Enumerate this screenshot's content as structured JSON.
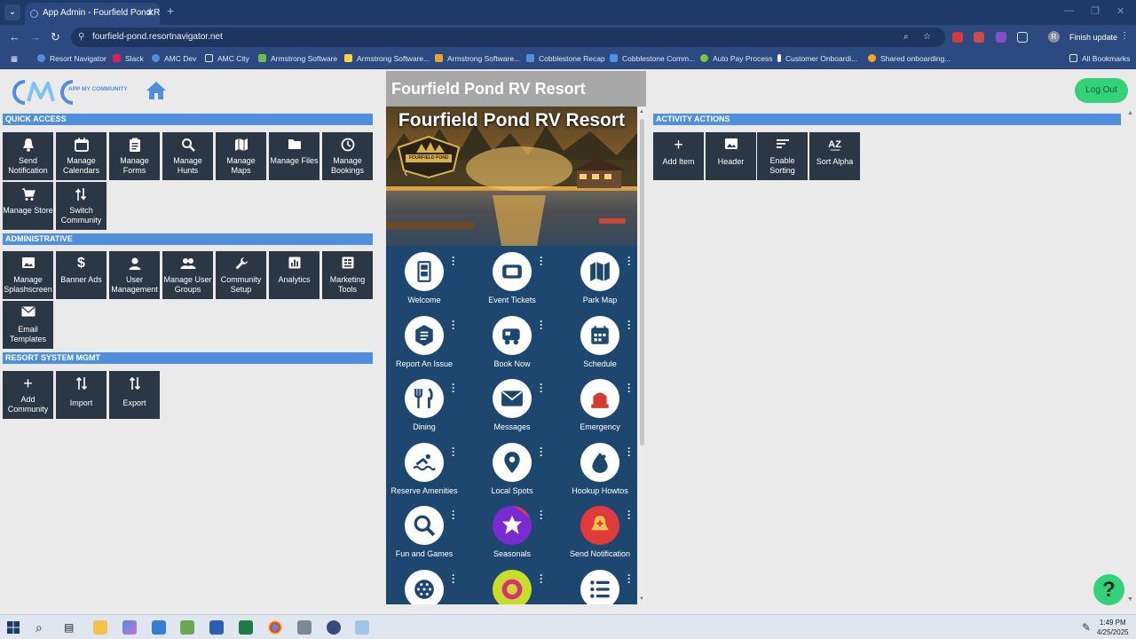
{
  "browser": {
    "tab_title": "App Admin - Fourfield Pond RV",
    "url": "fourfield-pond.resortnavigator.net",
    "update_label": "Finish update",
    "avatar_letter": "R",
    "bookmarks": [
      "Resort Navigator",
      "Slack",
      "AMC Dev",
      "AMC City",
      "Armstrong Software",
      "Armstrong Software...",
      "Armstrong Software...",
      "Cobblestone Recap",
      "Cobblestone Comm...",
      "Auto Pay Process",
      "Customer Onboardi...",
      "Shared onboarding..."
    ],
    "all_bookmarks": "All Bookmarks"
  },
  "app": {
    "logo_text": "APP MY COMMUNITY",
    "logout_label": "Log Out",
    "help_label": "?"
  },
  "sections": {
    "quick_access": "QUICK ACCESS",
    "administrative": "ADMINISTRATIVE",
    "resort_mgmt": "RESORT SYSTEM MGMT",
    "activity_actions": "ACTIVITY ACTIONS"
  },
  "quick_access": [
    {
      "label": "Send Notification",
      "icon": "bell-icon"
    },
    {
      "label": "Manage Calendars",
      "icon": "calendar-icon"
    },
    {
      "label": "Manage Forms",
      "icon": "clipboard-icon"
    },
    {
      "label": "Manage Hunts",
      "icon": "search-icon"
    },
    {
      "label": "Manage Maps",
      "icon": "map-icon"
    },
    {
      "label": "Manage Files",
      "icon": "folder-icon"
    },
    {
      "label": "Manage Bookings",
      "icon": "clock-icon"
    },
    {
      "label": "Manage Store",
      "icon": "cart-icon"
    },
    {
      "label": "Switch Community",
      "icon": "switch-icon"
    }
  ],
  "administrative": [
    {
      "label": "Manage Splashscreen",
      "icon": "image-icon"
    },
    {
      "label": "Banner Ads",
      "icon": "dollar-icon"
    },
    {
      "label": "User Management",
      "icon": "user-icon"
    },
    {
      "label": "Manage User Groups",
      "icon": "users-icon"
    },
    {
      "label": "Community Setup",
      "icon": "wrench-icon"
    },
    {
      "label": "Analytics",
      "icon": "chart-icon"
    },
    {
      "label": "Marketing Tools",
      "icon": "list-icon"
    },
    {
      "label": "Email Templates",
      "icon": "email-icon"
    }
  ],
  "resort_mgmt": [
    {
      "label": "Add Community",
      "icon": "plus-icon"
    },
    {
      "label": "Import",
      "icon": "import-icon"
    },
    {
      "label": "Export",
      "icon": "export-icon"
    }
  ],
  "activity_actions": [
    {
      "label": "Add Item",
      "icon": "plus-icon"
    },
    {
      "label": "Header",
      "icon": "image-icon"
    },
    {
      "label": "Enable Sorting",
      "icon": "sort-icon"
    },
    {
      "label": "Sort Alpha",
      "icon": "sort-alpha-icon"
    }
  ],
  "preview": {
    "header_title": "Fourfield Pond RV Resort",
    "banner_title": "Fourfield Pond RV Resort",
    "badge_text": "FOURFIELD POND",
    "items": [
      {
        "label": "Welcome",
        "icon": "door-icon"
      },
      {
        "label": "Event Tickets",
        "icon": "ticket-icon"
      },
      {
        "label": "Park Map",
        "icon": "map-icon"
      },
      {
        "label": "Report An Issue",
        "icon": "report-icon"
      },
      {
        "label": "Book Now",
        "icon": "rv-icon"
      },
      {
        "label": "Schedule",
        "icon": "calendar-icon"
      },
      {
        "label": "Dining",
        "icon": "utensils-icon"
      },
      {
        "label": "Messages",
        "icon": "envelope-icon"
      },
      {
        "label": "Emergency",
        "icon": "siren-icon"
      },
      {
        "label": "Reserve Amenities",
        "icon": "swimmer-icon"
      },
      {
        "label": "Local Spots",
        "icon": "pin-icon"
      },
      {
        "label": "Hookup Howtos",
        "icon": "water-icon"
      },
      {
        "label": "Fun and Games",
        "icon": "magnify-icon"
      },
      {
        "label": "Seasonals",
        "icon": "leaf-icon"
      },
      {
        "label": "Send Notification",
        "icon": "bell-plus-icon"
      },
      {
        "label": "",
        "icon": "ball-icon"
      },
      {
        "label": "",
        "icon": "donut-icon"
      },
      {
        "label": "",
        "icon": "list-icon"
      }
    ]
  },
  "taskbar": {
    "time": "1:49 PM",
    "date": "4/25/2025"
  },
  "colors": {
    "section_header": "#4f8fdb",
    "tile_bg": "#2b3745",
    "logout": "#33d17a",
    "preview_grid": "#1e4770"
  }
}
